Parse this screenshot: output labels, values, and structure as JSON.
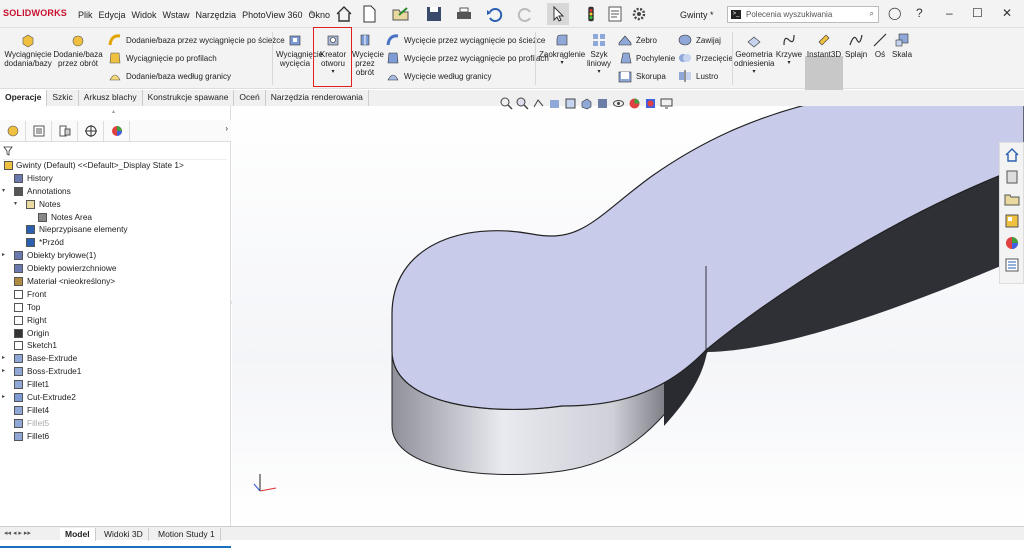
{
  "app": {
    "logo": "SOLIDWORKS",
    "doc_name": "Gwinty *"
  },
  "menu": [
    "Plik",
    "Edycja",
    "Widok",
    "Wstaw",
    "Narzędzia",
    "PhotoView 360",
    "Okno"
  ],
  "search": {
    "placeholder": "Polecenia wyszukiwania"
  },
  "ribbon": {
    "extrude_boss": "Wyciągnięcie dodania/bazy",
    "revolve_boss": "Dodanie/baza przez obrót",
    "sweep_boss": "Dodanie/baza przez wyciągnięcie po ścieżce",
    "loft_boss": "Wyciągnięcie po profilach",
    "boundary_boss": "Dodanie/baza według granicy",
    "extrude_cut": "Wyciągnięcie wycięcia",
    "hole_wizard": "Kreator otworu",
    "revolve_cut": "Wycięcie przez obrót",
    "sweep_cut": "Wycięcie przez wyciągnięcie po ścieżce",
    "loft_cut": "Wycięcie przez wyciągnięcie po profilach",
    "boundary_cut": "Wycięcie według granicy",
    "fillet": "Zaokrąglenie",
    "linear_pattern": "Szyk liniowy",
    "rib": "Żebro",
    "wrap": "Zawijaj",
    "draft": "Pochylenie",
    "intersect": "Przecięcie",
    "shell": "Skorupa",
    "mirror": "Lustro",
    "ref_geometry": "Geometria odniesienia",
    "curves": "Krzywe",
    "instant3d": "Instant3D",
    "spline": "Splajn",
    "axis": "Oś",
    "scale": "Skala"
  },
  "tabs": [
    "Operacje",
    "Szkic",
    "Arkusz blachy",
    "Konstrukcje spawane",
    "Oceń",
    "Narzędzia renderowania"
  ],
  "tree": [
    {
      "label": "Gwinty (Default) <<Default>_Display State 1>",
      "level": 0,
      "icon": "part-icon",
      "exp": ""
    },
    {
      "label": "History",
      "level": 1,
      "icon": "history-icon",
      "exp": ""
    },
    {
      "label": "Annotations",
      "level": 1,
      "icon": "annotations-icon",
      "exp": "▾"
    },
    {
      "label": "Notes",
      "level": 2,
      "icon": "folder-icon",
      "exp": "▾"
    },
    {
      "label": "Notes Area",
      "level": 3,
      "icon": "notes-area-icon",
      "exp": ""
    },
    {
      "label": "Nieprzypisane elementy",
      "level": 2,
      "icon": "unassigned-icon",
      "exp": ""
    },
    {
      "label": "*Przód",
      "level": 2,
      "icon": "view-icon",
      "exp": ""
    },
    {
      "label": "Obiekty bryłowe(1)",
      "level": 1,
      "icon": "solid-bodies-icon",
      "exp": "▸"
    },
    {
      "label": "Obiekty powierzchniowe",
      "level": 1,
      "icon": "surface-bodies-icon",
      "exp": ""
    },
    {
      "label": "Materiał <nieokreślony>",
      "level": 1,
      "icon": "material-icon",
      "exp": ""
    },
    {
      "label": "Front",
      "level": 1,
      "icon": "plane-icon",
      "exp": ""
    },
    {
      "label": "Top",
      "level": 1,
      "icon": "plane-icon",
      "exp": ""
    },
    {
      "label": "Right",
      "level": 1,
      "icon": "plane-icon",
      "exp": ""
    },
    {
      "label": "Origin",
      "level": 1,
      "icon": "origin-icon",
      "exp": ""
    },
    {
      "label": "Sketch1",
      "level": 1,
      "icon": "sketch-icon",
      "exp": ""
    },
    {
      "label": "Base-Extrude",
      "level": 1,
      "icon": "extrude-icon",
      "exp": "▸"
    },
    {
      "label": "Boss-Extrude1",
      "level": 1,
      "icon": "extrude-icon",
      "exp": "▸"
    },
    {
      "label": "Fillet1",
      "level": 1,
      "icon": "fillet-icon",
      "exp": ""
    },
    {
      "label": "Cut-Extrude2",
      "level": 1,
      "icon": "cut-extrude-icon",
      "exp": "▸"
    },
    {
      "label": "Fillet4",
      "level": 1,
      "icon": "fillet-icon",
      "exp": ""
    },
    {
      "label": "Fillet5",
      "level": 1,
      "icon": "fillet-icon",
      "exp": "",
      "dim": true
    },
    {
      "label": "Fillet6",
      "level": 1,
      "icon": "fillet-icon",
      "exp": ""
    }
  ],
  "bottom_tabs": [
    "Model",
    "Widoki 3D",
    "Motion Study 1"
  ],
  "colors": {
    "accent": "#c8102e",
    "top_face": "#c9cbea",
    "side_dark": "#2f3036",
    "highlight": "#e02020",
    "rollback": "#1a6fc0"
  }
}
